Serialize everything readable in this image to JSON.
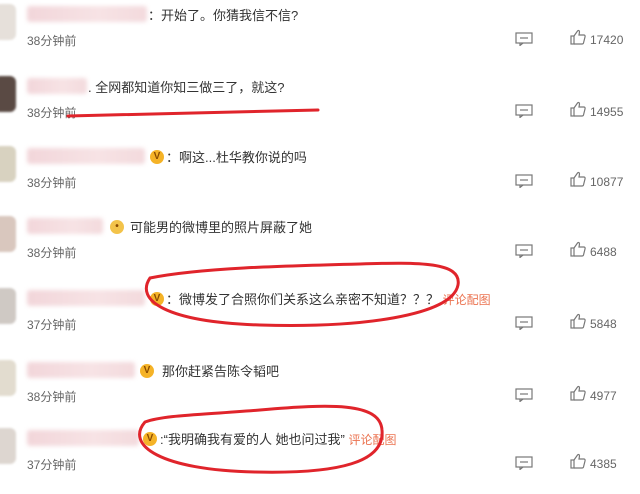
{
  "comments": [
    {
      "text": "：开始了。你猜我信不信?",
      "time": "38分钟前",
      "likes": "17420",
      "has_badge": false,
      "photo_link": ""
    },
    {
      "text": ". 全网都知道你知三做三了，就这?",
      "time": "38分钟前",
      "likes": "14955",
      "has_badge": false,
      "photo_link": ""
    },
    {
      "text": "：啊这...杜华教你说的吗",
      "time": "38分钟前",
      "likes": "10877",
      "has_badge": true,
      "photo_link": ""
    },
    {
      "text": "可能男的微博里的照片屏蔽了她",
      "time": "38分钟前",
      "likes": "6488",
      "has_badge": false,
      "photo_link": ""
    },
    {
      "text": "：微博发了合照你们关系这么亲密不知道？？？",
      "time": "37分钟前",
      "likes": "5848",
      "has_badge": true,
      "photo_link": "评论配图"
    },
    {
      "text": "那你赶紧告陈令韬吧",
      "time": "38分钟前",
      "likes": "4977",
      "has_badge": true,
      "photo_link": ""
    },
    {
      "text": ":“我明确我有爱的人 她也问过我”",
      "time": "37分钟前",
      "likes": "4385",
      "has_badge": true,
      "photo_link": "评论配图"
    }
  ],
  "icons": {
    "reply": "comment-icon",
    "like": "thumbs-up-icon",
    "badge": "vip-badge-icon"
  },
  "colors": {
    "text": "#333333",
    "meta": "#666666",
    "link": "#eb7350",
    "annotation": "#e0242b"
  }
}
